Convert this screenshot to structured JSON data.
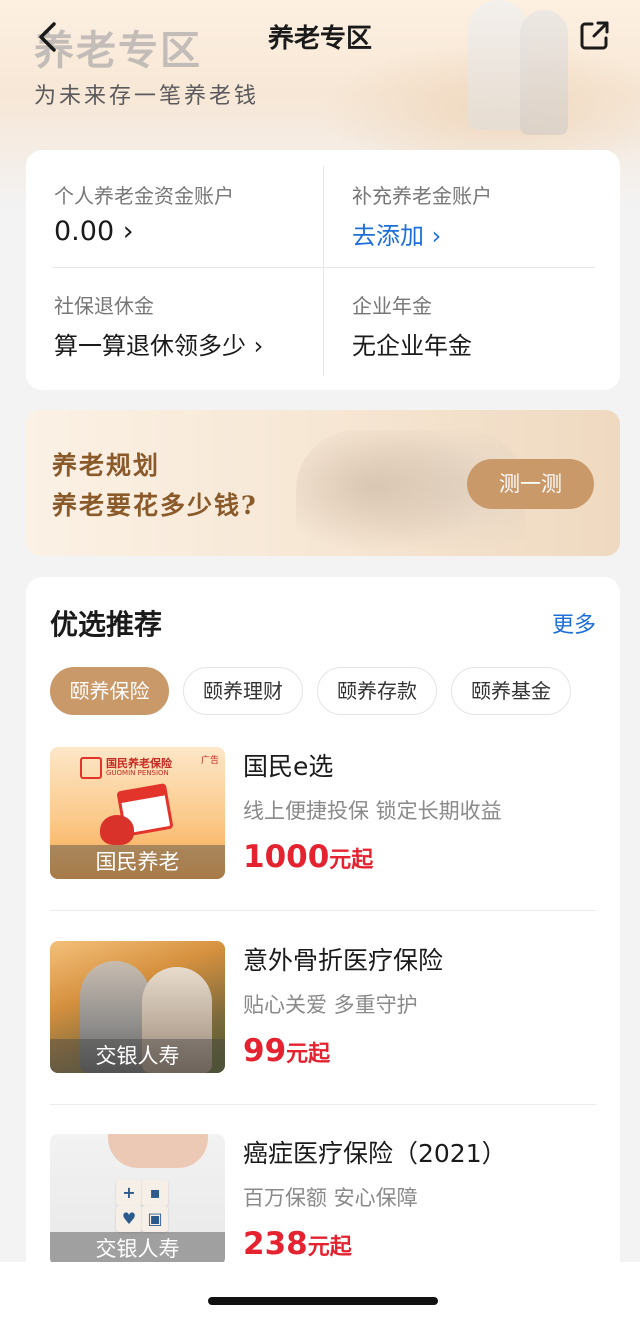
{
  "header": {
    "bg_title": "养老专区",
    "bg_subtitle": "为未来存一笔养老钱",
    "nav_title": "养老专区",
    "back_icon": "chevron-left-icon",
    "share_icon": "share-external-icon"
  },
  "accounts": {
    "personal_label": "个人养老金资金账户",
    "personal_value": "0.00 ›",
    "supplement_label": "补充养老金账户",
    "supplement_value": "去添加 ›",
    "social_label": "社保退休金",
    "social_value": "算一算退休领多少 ›",
    "enterprise_label": "企业年金",
    "enterprise_value": "无企业年金"
  },
  "banner": {
    "line1": "养老规划",
    "line2": "养老要花多少钱?",
    "button": "测一测"
  },
  "recommend": {
    "title": "优选推荐",
    "more": "更多",
    "tabs": [
      {
        "label": "颐养保险",
        "active": true
      },
      {
        "label": "颐养理财",
        "active": false
      },
      {
        "label": "颐养存款",
        "active": false
      },
      {
        "label": "颐养基金",
        "active": false
      }
    ],
    "products": [
      {
        "caption": "国民养老",
        "name": "国民e选",
        "desc": "线上便捷投保 锁定长期收益",
        "price": "1000",
        "unit": "元起",
        "logo_title": "国民养老保险",
        "logo_sub": "GUOMIN PENSION",
        "ad": "广告"
      },
      {
        "caption": "交银人寿",
        "name": "意外骨折医疗保险",
        "desc": "贴心关爱 多重守护",
        "price": "99",
        "unit": "元起"
      },
      {
        "caption": "交银人寿",
        "name": "癌症医疗保险（2021）",
        "desc": "百万保额 安心保障",
        "price": "238",
        "unit": "元起"
      }
    ]
  },
  "colors": {
    "accent": "#c9996a",
    "link": "#1e6fd9",
    "price": "#e5222f"
  }
}
